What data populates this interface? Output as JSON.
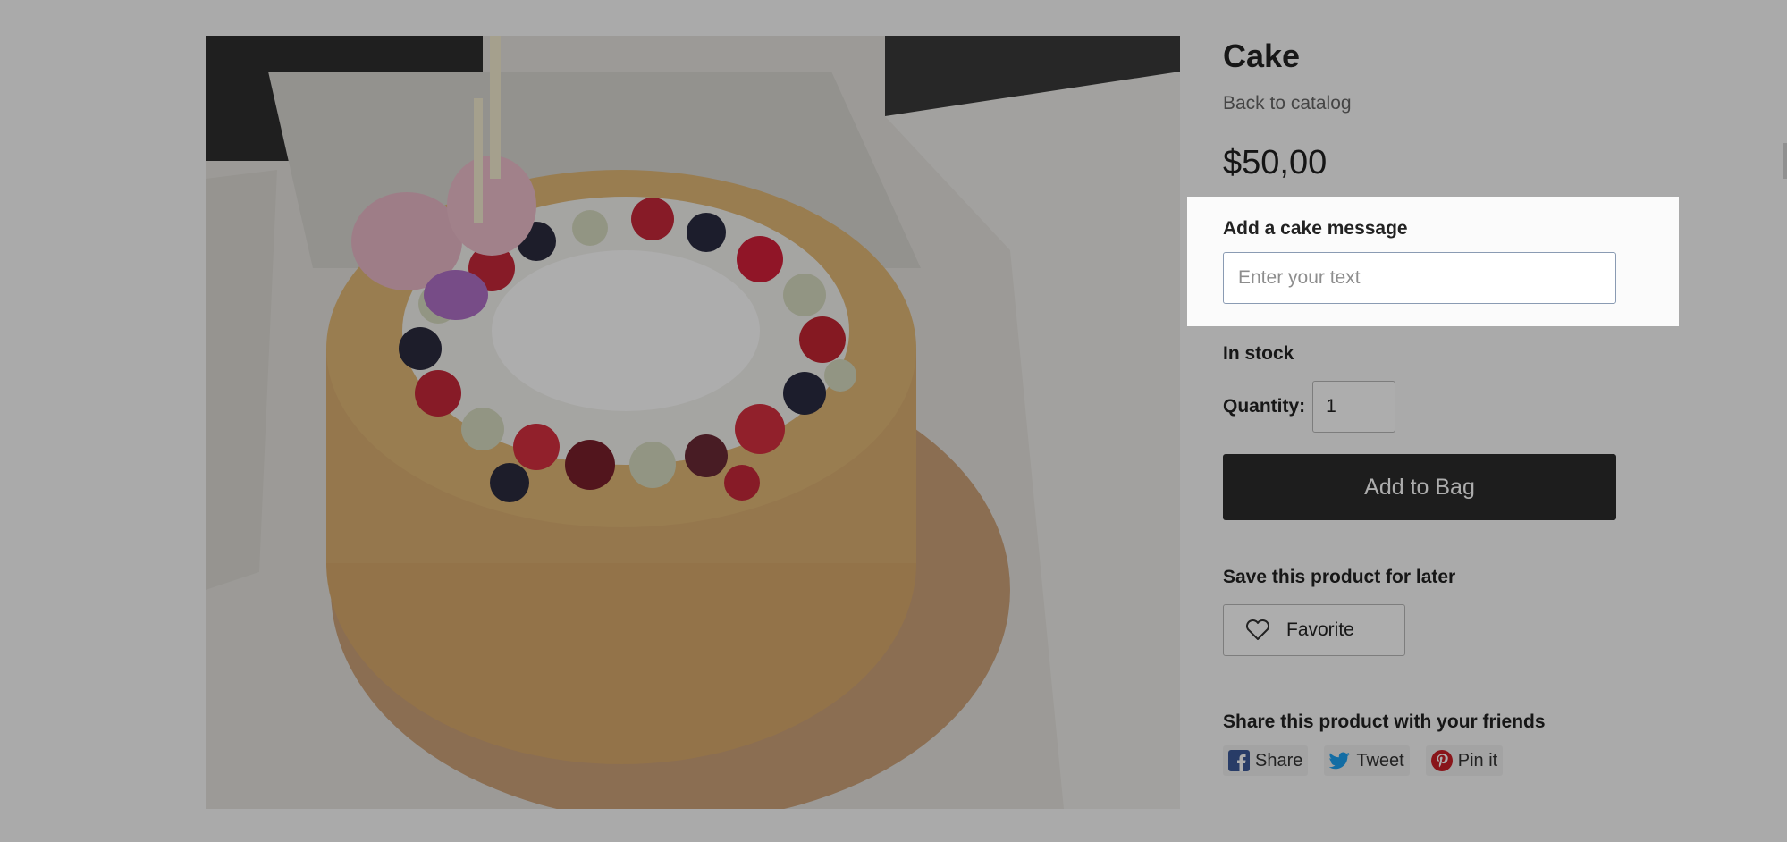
{
  "product": {
    "title": "Cake",
    "back_label": "Back to catalog",
    "price": "$50,00",
    "image_alt": "Cake"
  },
  "message": {
    "label": "Add a cake message",
    "placeholder": "Enter your text",
    "value": ""
  },
  "stock": {
    "status": "In stock"
  },
  "quantity": {
    "label": "Quantity:",
    "value": "1"
  },
  "cart": {
    "add_label": "Add to Bag"
  },
  "save": {
    "heading": "Save this product for later",
    "favorite_label": "Favorite"
  },
  "share": {
    "heading": "Share this product with your friends",
    "buttons": [
      {
        "label": "Share",
        "icon": "facebook-icon",
        "color": "#3b5998"
      },
      {
        "label": "Tweet",
        "icon": "twitter-icon",
        "color": "#1da1f2"
      },
      {
        "label": "Pin it",
        "icon": "pinterest-icon",
        "color": "#cb2027"
      }
    ]
  },
  "colors": {
    "button_dark": "#2b2b2b",
    "overlay": "rgba(0,0,0,0.32)",
    "input_border": "#8a9bb3"
  }
}
